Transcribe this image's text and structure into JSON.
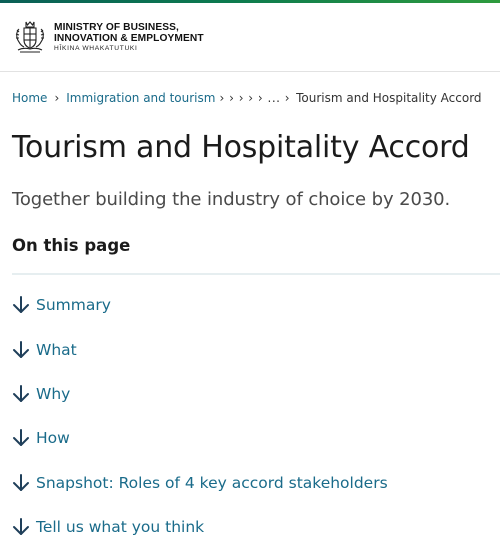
{
  "header": {
    "logo_line1": "MINISTRY OF BUSINESS,",
    "logo_line2": "INNOVATION & EMPLOYMENT",
    "logo_line3": "HĪKINA WHAKATUTUKI"
  },
  "breadcrumb": {
    "home": "Home",
    "sep": "›",
    "section": "Immigration and tourism",
    "collapsed": "› › › › › ... ›",
    "current": "Tourism and Hospitality Accord"
  },
  "page": {
    "title": "Tourism and Hospitality Accord",
    "lead": "Together building the industry of choice by 2030."
  },
  "on_this_page": {
    "heading": "On this page",
    "items": [
      {
        "label": "Summary"
      },
      {
        "label": "What"
      },
      {
        "label": "Why"
      },
      {
        "label": "How"
      },
      {
        "label": "Snapshot: Roles of 4 key accord stakeholders"
      },
      {
        "label": "Tell us what you think"
      }
    ]
  },
  "colors": {
    "link": "#1a6b8a",
    "text": "#1b1b1b",
    "accent_bar": "#0c7a4f"
  },
  "icons": {
    "crest": "nz-coat-of-arms-icon",
    "toc_arrow": "arrow-down-icon"
  }
}
